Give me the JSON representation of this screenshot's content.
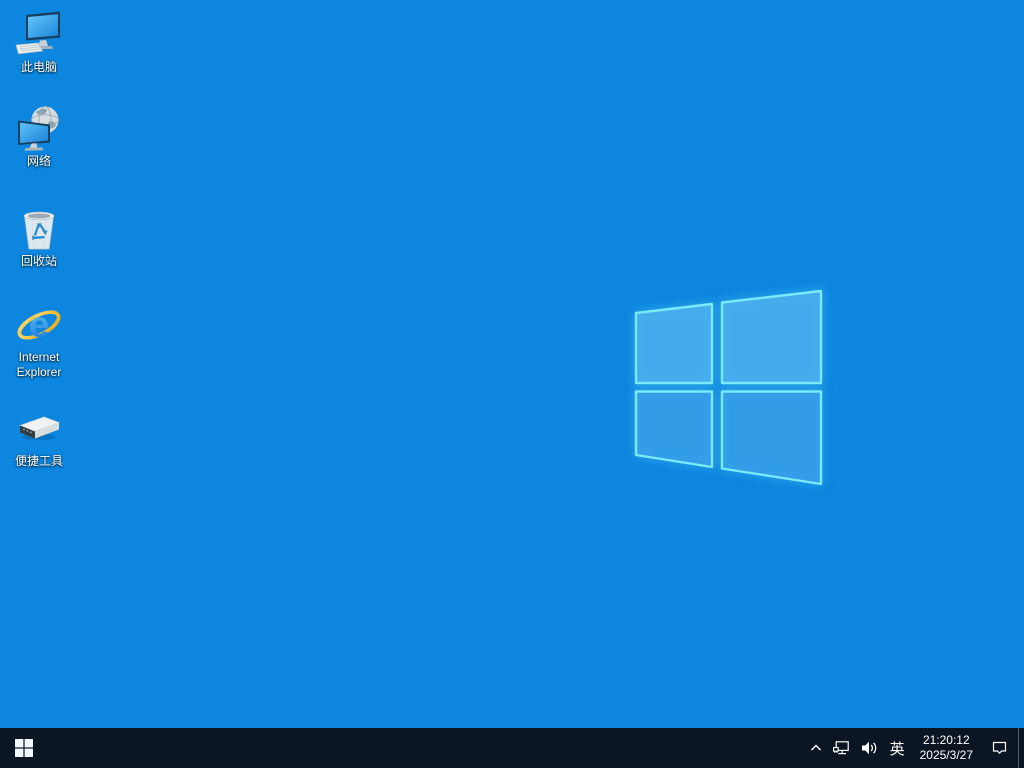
{
  "desktop": {
    "wallpaper": "windows-10-default-light-rays",
    "icons": [
      {
        "name": "this-pc",
        "label": "此电脑"
      },
      {
        "name": "network",
        "label": "网络"
      },
      {
        "name": "recycle-bin",
        "label": "回收站"
      },
      {
        "name": "internet-explorer",
        "label": "Internet Explorer"
      },
      {
        "name": "tools-drive",
        "label": "便捷工具"
      }
    ]
  },
  "taskbar": {
    "start": {
      "tooltip_glyph": "windows-logo"
    },
    "tray": {
      "hidden_icons_glyph": "chevron-up",
      "network_glyph": "ethernet-network",
      "volume_glyph": "speaker",
      "ime_indicator": "英",
      "time": "21:20:12",
      "date": "2025/3/27",
      "action_center_glyph": "notification-bubble"
    }
  },
  "colors": {
    "taskbar_background": "#0b1523",
    "wallpaper_left": "#0a9fe8",
    "wallpaper_right": "#123fa9",
    "logo_edge_glow": "#79eaf8",
    "icon_label_text": "#ffffff",
    "ie_blue": "#1a86dd",
    "ie_gold": "#f2c12e",
    "recycle_arrow_blue": "#2a8ad2"
  }
}
